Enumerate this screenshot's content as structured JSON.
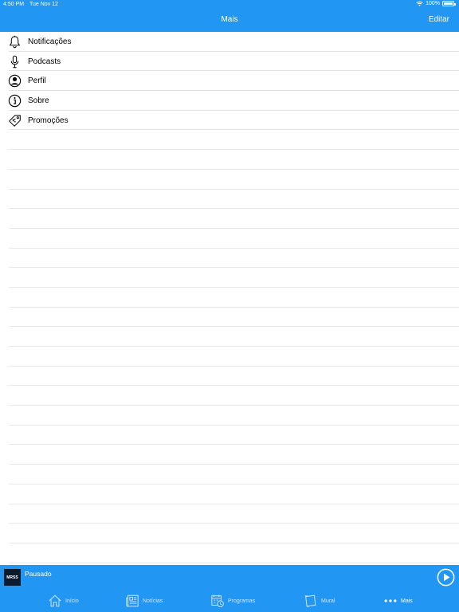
{
  "status_bar": {
    "time": "4:50 PM",
    "date": "Tue Nov 12",
    "battery": "100%"
  },
  "nav": {
    "title": "Mais",
    "edit_label": "Editar"
  },
  "menu_items": [
    {
      "label": "Notificações",
      "icon": "bell-icon"
    },
    {
      "label": "Podcasts",
      "icon": "microphone-icon"
    },
    {
      "label": "Perfil",
      "icon": "profile-icon"
    },
    {
      "label": "Sobre",
      "icon": "info-icon"
    },
    {
      "label": "Promoções",
      "icon": "tag-icon"
    }
  ],
  "player": {
    "status": "Pausado",
    "thumb_text": "MRSS"
  },
  "tabs": [
    {
      "label": "Início",
      "icon": "home-icon",
      "active": false
    },
    {
      "label": "Notícias",
      "icon": "newspaper-icon",
      "active": false
    },
    {
      "label": "Programas",
      "icon": "schedule-icon",
      "active": false
    },
    {
      "label": "Mural",
      "icon": "board-icon",
      "active": false
    },
    {
      "label": "Mais",
      "icon": "more-icon",
      "active": true
    }
  ],
  "colors": {
    "accent": "#2196f3",
    "text": "#000000",
    "separator": "#e2e2e2"
  }
}
